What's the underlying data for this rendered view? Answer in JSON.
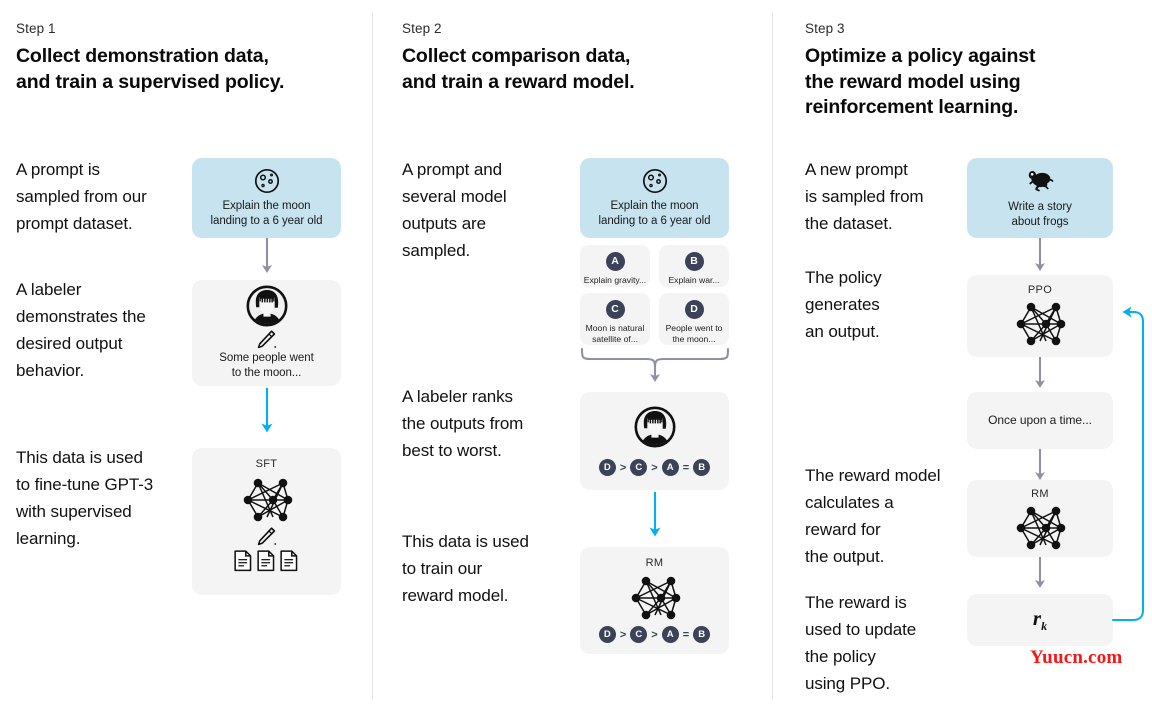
{
  "colors": {
    "prompt_box_bg": "#c7e3ef",
    "model_box_bg": "#f4f4f4",
    "arrow_grey": "#8f90a6",
    "arrow_blue": "#00b0f0",
    "pill_bg": "#3c4257",
    "separator": "#e3e3e4",
    "watermark": "#fc1313"
  },
  "watermark": "Yuucn.com",
  "steps": [
    {
      "label": "Step 1",
      "title": "Collect demonstration data,\nand train a supervised policy.",
      "paragraphs": [
        "A prompt is\nsampled from our\nprompt dataset.",
        "A labeler\ndemonstrates the\ndesired output\nbehavior.",
        "This data is used\nto fine-tune GPT-3\nwith supervised\nlearning."
      ],
      "boxes": {
        "prompt": {
          "icon": "moon-icon",
          "text": "Explain the moon\nlanding to a 6 year old"
        },
        "demonstration": {
          "icon": "labeler-avatar-icon",
          "sub_icon": "pencil-icon",
          "text": "Some people went\nto the moon..."
        },
        "sft": {
          "caption": "SFT",
          "icon": "neural-network-icon",
          "sub_icon": "pencil-icon",
          "docs_icon": "documents-icon"
        }
      }
    },
    {
      "label": "Step 2",
      "title": "Collect comparison data,\nand train a reward model.",
      "paragraphs": [
        "A prompt and\nseveral model\noutputs are\nsampled.",
        "A labeler ranks\nthe outputs from\nbest to worst.",
        "This data is used\nto train our\nreward model."
      ],
      "boxes": {
        "prompt": {
          "icon": "moon-icon",
          "text": "Explain the moon\nlanding to a 6 year old"
        },
        "outputs": [
          {
            "letter": "A",
            "text": "Explain gravity..."
          },
          {
            "letter": "B",
            "text": "Explain war..."
          },
          {
            "letter": "C",
            "text": "Moon is natural\nsatellite of..."
          },
          {
            "letter": "D",
            "text": "People went to\nthe moon..."
          }
        ],
        "ranking_box": {
          "icon": "labeler-avatar-icon",
          "ranking": [
            "D",
            ">",
            "C",
            ">",
            "A",
            "=",
            "B"
          ]
        },
        "rm": {
          "caption": "RM",
          "icon": "neural-network-icon",
          "ranking": [
            "D",
            ">",
            "C",
            ">",
            "A",
            "=",
            "B"
          ]
        }
      }
    },
    {
      "label": "Step 3",
      "title": "Optimize a policy against\nthe reward model using\nreinforcement learning.",
      "paragraphs": [
        "A new prompt\nis sampled from\nthe dataset.",
        "The policy\ngenerates\nan output.",
        "The reward model\ncalculates a\nreward for\nthe output.",
        "The reward is\nused to update\nthe policy\nusing PPO."
      ],
      "boxes": {
        "prompt": {
          "icon": "frog-icon",
          "text": "Write a story\nabout frogs"
        },
        "ppo": {
          "caption": "PPO",
          "icon": "neural-network-icon"
        },
        "output": {
          "text": "Once upon a time..."
        },
        "rm": {
          "caption": "RM",
          "icon": "neural-network-icon"
        },
        "reward": {
          "value": "r",
          "subscript": "k"
        }
      }
    }
  ]
}
